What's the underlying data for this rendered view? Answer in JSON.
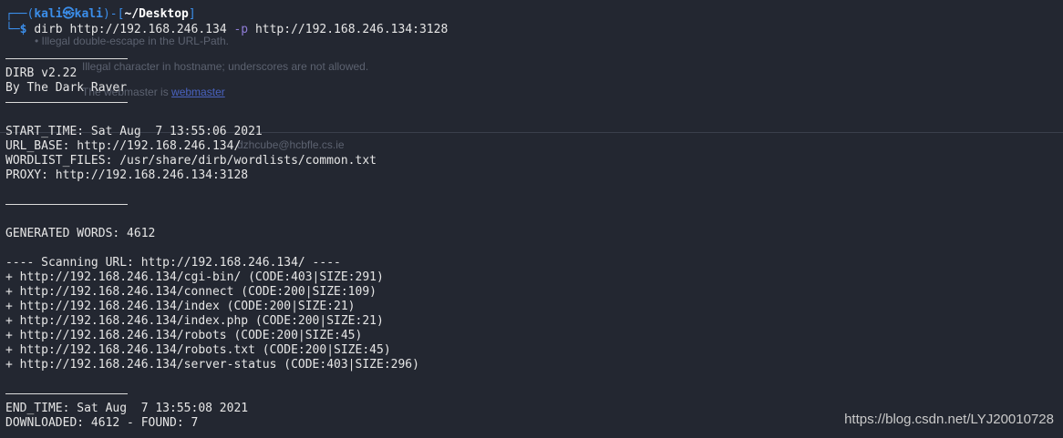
{
  "prompt": {
    "corner_top": "┌──(",
    "user": "kali",
    "at": "㉿",
    "host": "kali",
    "mid": ")-[",
    "path": "~/Desktop",
    "end": "]",
    "corner_bottom": "└─",
    "dollar": "$",
    "command": "dirb",
    "arg1": "http://192.168.246.134",
    "flag": "-p",
    "arg2": "http://192.168.246.134:3128"
  },
  "ghost_overlay": {
    "line1": "• Illegal double-escape in the URL-Path.",
    "line2": "Illegal character in hostname; underscores are not allowed.",
    "line3_prefix": "The webmaster is ",
    "line3_link": "webmaster",
    "line4": "dzhcube@hcbfle.cs.ie"
  },
  "output": {
    "banner_version": "DIRB v2.22",
    "banner_author": "By The Dark Raver",
    "start_time": "START_TIME: Sat Aug  7 13:55:06 2021",
    "url_base": "URL_BASE: http://192.168.246.134/",
    "wordlist": "WORDLIST_FILES: /usr/share/dirb/wordlists/common.txt",
    "proxy": "PROXY: http://192.168.246.134:3128",
    "generated": "GENERATED WORDS: 4612",
    "scanning": "---- Scanning URL: http://192.168.246.134/ ----",
    "results": [
      "+ http://192.168.246.134/cgi-bin/ (CODE:403|SIZE:291)",
      "+ http://192.168.246.134/connect (CODE:200|SIZE:109)",
      "+ http://192.168.246.134/index (CODE:200|SIZE:21)",
      "+ http://192.168.246.134/index.php (CODE:200|SIZE:21)",
      "+ http://192.168.246.134/robots (CODE:200|SIZE:45)",
      "+ http://192.168.246.134/robots.txt (CODE:200|SIZE:45)",
      "+ http://192.168.246.134/server-status (CODE:403|SIZE:296)"
    ],
    "end_time": "END_TIME: Sat Aug  7 13:55:08 2021",
    "downloaded": "DOWNLOADED: 4612 - FOUND: 7"
  },
  "watermark": "https://blog.csdn.net/LYJ20010728"
}
